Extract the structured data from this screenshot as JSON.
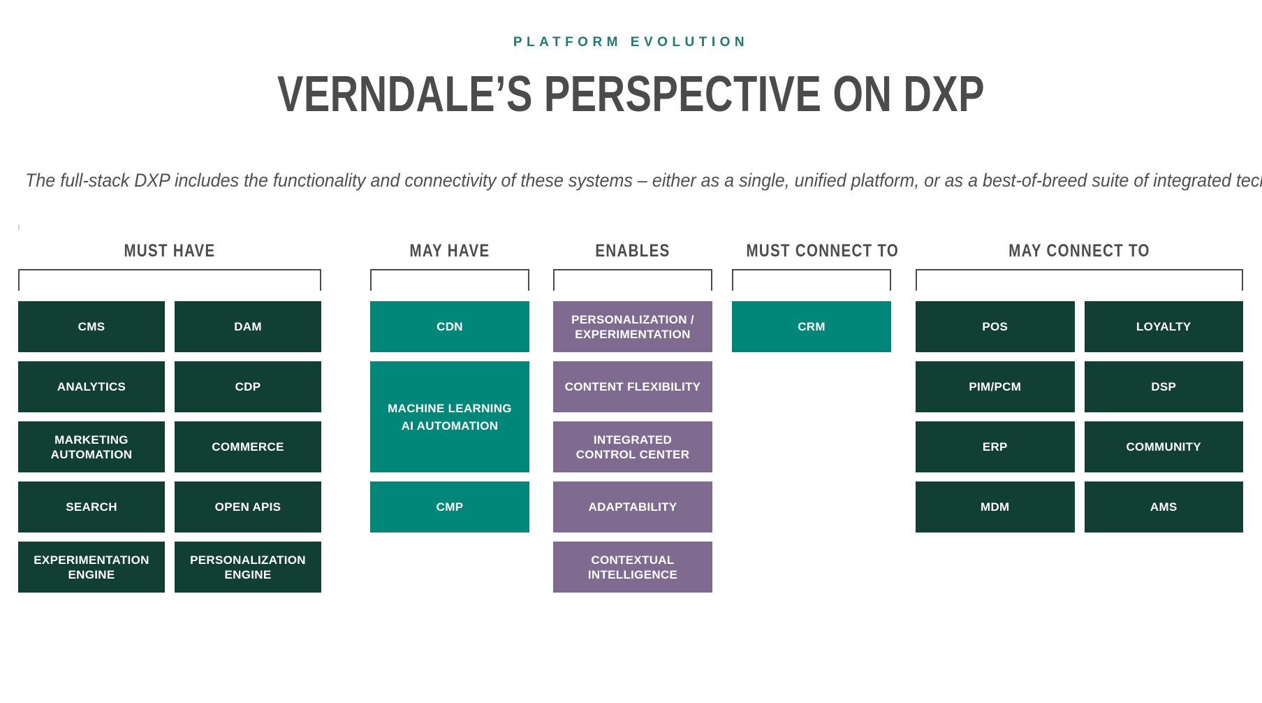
{
  "header": {
    "eyebrow": "PLATFORM EVOLUTION",
    "title": "VERNDALE’S PERSPECTIVE ON DXP",
    "subtitle": "The full-stack DXP includes the functionality and connectivity of these systems – either as a single, unified platform, or as a best-of-breed suite of integrated technologies:"
  },
  "colors": {
    "eyebrow_teal": "#24786E",
    "title_gray": "#4B4B4B",
    "tile_green": "#123F33",
    "tile_teal": "#00877A",
    "tile_purple": "#806B90",
    "bracket_gray": "#4B4B4B",
    "background": "#FFFFFF"
  },
  "columns": [
    {
      "title": "MUST HAVE",
      "tiles": [
        {
          "label": "CMS",
          "color": "green"
        },
        {
          "label": "DAM",
          "color": "green"
        },
        {
          "label": "ANALYTICS",
          "color": "green"
        },
        {
          "label": "CDP",
          "color": "green"
        },
        {
          "label_lines": [
            "MARKETING",
            "AUTOMATION"
          ],
          "color": "green"
        },
        {
          "label": "COMMERCE",
          "color": "green"
        },
        {
          "label": "SEARCH",
          "color": "green"
        },
        {
          "label": "OPEN APIS",
          "color": "green"
        },
        {
          "label_lines": [
            "EXPERIMENTATION",
            "ENGINE"
          ],
          "color": "green"
        },
        {
          "label_lines": [
            "PERSONALIZATION",
            "ENGINE"
          ],
          "color": "green"
        }
      ]
    },
    {
      "title": "MAY HAVE",
      "tiles": [
        {
          "label": "CDN",
          "color": "teal"
        },
        {
          "label_lines": [
            "MACHINE LEARNING",
            "AI AUTOMATION"
          ],
          "color": "teal",
          "tall": true
        },
        {
          "label": "CMP",
          "color": "teal"
        }
      ]
    },
    {
      "title": "ENABLES",
      "tiles": [
        {
          "label_lines": [
            "PERSONALIZATION /",
            "EXPERIMENTATION"
          ],
          "color": "purple"
        },
        {
          "label": "CONTENT FLEXIBILITY",
          "color": "purple"
        },
        {
          "label_lines": [
            "INTEGRATED",
            "CONTROL CENTER"
          ],
          "color": "purple"
        },
        {
          "label": "ADAPTABILITY",
          "color": "purple"
        },
        {
          "label_lines": [
            "CONTEXTUAL",
            "INTELLIGENCE"
          ],
          "color": "purple"
        }
      ]
    },
    {
      "title": "MUST CONNECT TO",
      "tiles": [
        {
          "label": "CRM",
          "color": "teal"
        }
      ]
    },
    {
      "title": "MAY CONNECT TO",
      "tiles": [
        {
          "label": "POS",
          "color": "green"
        },
        {
          "label": "LOYALTY",
          "color": "green"
        },
        {
          "label": "PIM/PCM",
          "color": "green"
        },
        {
          "label": "DSP",
          "color": "green"
        },
        {
          "label": "ERP",
          "color": "green"
        },
        {
          "label": "COMMUNITY",
          "color": "green"
        },
        {
          "label": "MDM",
          "color": "green"
        },
        {
          "label": "AMS",
          "color": "green"
        }
      ]
    }
  ]
}
